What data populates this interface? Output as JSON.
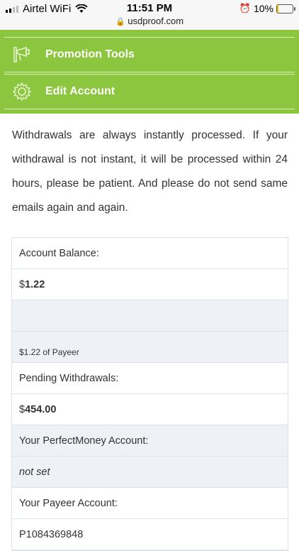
{
  "status_bar": {
    "carrier": "Airtel WiFi",
    "time": "11:51 PM",
    "battery": "10%",
    "battery_level": 0.1,
    "url": "usdproof.com"
  },
  "menu": {
    "items": [
      {
        "label": "Promotion Tools",
        "icon": "bullhorn-icon"
      },
      {
        "label": "Edit Account",
        "icon": "gear-icon"
      }
    ]
  },
  "notice": "Withdrawals are always instantly processed. If your withdrawal is not instant, it will be processed within 24 hours, please be patient. And please do not send same emails again and again.",
  "account": {
    "balance_label": "Account Balance:",
    "balance_currency": "$",
    "balance_value": "1.22",
    "payeer_note": "$1.22 of Payeer",
    "pending_label": "Pending Withdrawals:",
    "pending_currency": "$",
    "pending_value": "454.00",
    "perfectmoney_label": "Your PerfectMoney Account:",
    "perfectmoney_value": "not set",
    "payeer_label": "Your Payeer Account:",
    "payeer_value": "P1084369848"
  },
  "colors": {
    "menu_bg": "#8cc63f",
    "alt_row": "#eef2f7"
  }
}
